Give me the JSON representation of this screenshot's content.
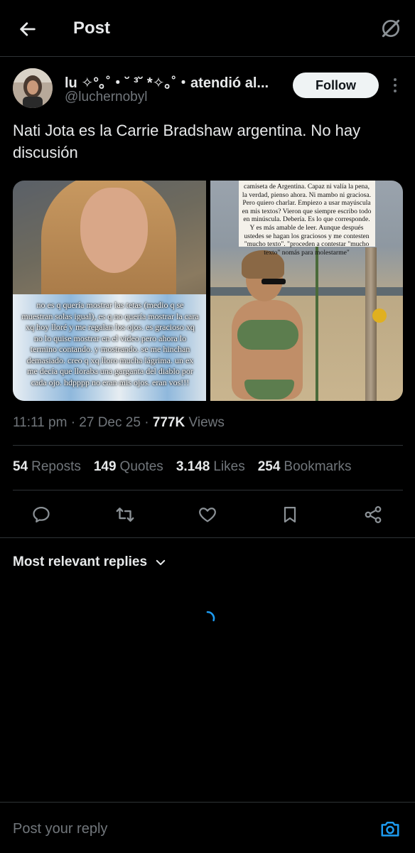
{
  "header": {
    "title": "Post",
    "back_icon": "arrow-left-icon",
    "grok_icon": "grok-icon"
  },
  "author": {
    "display_name": "lu ✧°｡˚・˘ ³˘ *✧｡˚・atendió al...",
    "handle": "@luchernobyl",
    "follow_label": "Follow"
  },
  "post": {
    "text": "Nati Jota es la Carrie Bradshaw argentina. No hay discusión",
    "image1_overlay_text": "no es q quería mostrar las tetas (medio q se muestran solas igual), es q no quería mostrar la cara xq hoy lloré y me regalan los ojos. es gracioso xq no lo quise mostrar en el video pero ahora lo termino contando. y mostrando. se me hinchan demasiado. creo q xq lloro mucha lágrima. un ex me decía que lloraba una garganta del diablo por cada ojo. hdpppp no eran mis ojos. eran vos!!!",
    "image2_note_text": "camiseta de Argentina. Capaz ni valía la pena, la verdad, pienso ahora. Ni mambo ni graciosa. Pero quiero charlar. Empiezo a usar mayúscula en mis textos? Vieron que siempre escribo todo en minúscula. Debería. Es lo que corresponde. Y es más amable de leer. Aunque después ustedes se hagan los graciosos y me contesten \"mucho texto\". \"proceden a contestar \"mucho texto\" nomás para molestarme\""
  },
  "meta": {
    "time": "11:11 pm",
    "date": "27 Dec 25",
    "views_count": "777K",
    "views_label": "Views"
  },
  "stats": [
    {
      "count": "54",
      "label": "Reposts"
    },
    {
      "count": "149",
      "label": "Quotes"
    },
    {
      "count": "3.148",
      "label": "Likes"
    },
    {
      "count": "254",
      "label": "Bookmarks"
    }
  ],
  "actions": [
    "reply-icon",
    "repost-icon",
    "like-icon",
    "bookmark-icon",
    "share-icon"
  ],
  "replies": {
    "filter_label": "Most relevant replies"
  },
  "reply_bar": {
    "placeholder": "Post your reply"
  },
  "colors": {
    "background": "#000000",
    "text_primary": "#e7e9ea",
    "text_secondary": "#71767b",
    "accent": "#1d9bf0",
    "border": "#2f3336"
  }
}
